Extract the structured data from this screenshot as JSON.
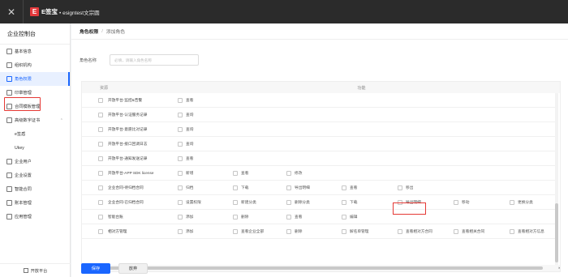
{
  "topbar": {
    "brand": "E签宝",
    "tenant": "• esigntest文宗圆"
  },
  "sidebar": {
    "title": "企业控制台",
    "items": [
      {
        "label": "基本信息"
      },
      {
        "label": "组织机构"
      },
      {
        "label": "角色权限"
      },
      {
        "label": "印章管理"
      },
      {
        "label": "合同模板管理"
      },
      {
        "label": "高级数字证书"
      },
      {
        "label": "e签盾"
      },
      {
        "label": "Ukey"
      },
      {
        "label": "企业用户"
      },
      {
        "label": "企业设置"
      },
      {
        "label": "智能合同"
      },
      {
        "label": "账本管理"
      },
      {
        "label": "应用管理"
      }
    ],
    "footer": "开放平台"
  },
  "breadcrumb": {
    "b1": "角色权限",
    "sep": "/",
    "b2": "添加角色"
  },
  "form": {
    "name_label": "角色名称",
    "name_placeholder": "必填，请输入角色名称"
  },
  "table": {
    "headers": {
      "resource": "资源",
      "function": "功能"
    },
    "rows": [
      {
        "name": "开放平台-监控&告警",
        "funcs": [
          "查看"
        ]
      },
      {
        "name": "开放平台-认证服务记录",
        "funcs": [
          "查询"
        ]
      },
      {
        "name": "开放平台-意愿比对记录",
        "funcs": [
          "查询"
        ]
      },
      {
        "name": "开放平台-接口回调日志",
        "funcs": [
          "查询"
        ]
      },
      {
        "name": "开放平台-通知发送记录",
        "funcs": [
          "查看"
        ]
      },
      {
        "name": "开放平台-APP SDK license",
        "funcs": [
          "新增",
          "查看",
          "修改"
        ]
      },
      {
        "name": "企业合同-待归档合同",
        "funcs": [
          "归档",
          "下载",
          "导出明细",
          "查看",
          "移出"
        ]
      },
      {
        "name": "企业合同-已归档合同",
        "funcs": [
          "设置权限",
          "新建分类",
          "删除分类",
          "下载",
          "导出明细",
          "移动",
          "更换分类"
        ]
      },
      {
        "name": "智能台账",
        "funcs": [
          "添加",
          "删除",
          "查看",
          "编辑"
        ]
      },
      {
        "name": "相对方管理",
        "funcs": [
          "添加",
          "查看企业全部",
          "删除",
          "解名单管理",
          "查看相对方合同",
          "查看相关合同",
          "查看相对方信息"
        ]
      }
    ]
  },
  "buttons": {
    "save": "保存",
    "cancel": "放弃"
  }
}
